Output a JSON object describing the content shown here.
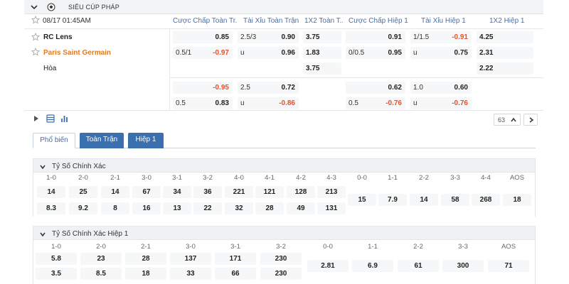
{
  "league": {
    "name": "SIÊU CÚP PHÁP"
  },
  "match": {
    "datetime": "08/17 01:45AM",
    "home": "RC Lens",
    "away": "Paris Saint Germain",
    "draw": "Hòa"
  },
  "columns": [
    "Cược Chấp Toàn Tr...",
    "Tài Xỉu Toàn Trận",
    "1X2 Toàn T...",
    "Cược Chấp Hiệp 1",
    "Tài Xỉu Hiệp 1",
    "1X2 Hiệp 1"
  ],
  "odds": {
    "hdp_ft": [
      {
        "line": "",
        "val": "0.85",
        "neg": false
      },
      {
        "line": "0.5/1",
        "val": "-0.97",
        "neg": true
      },
      {
        "line": "",
        "val": "-0.95",
        "neg": true
      },
      {
        "line": "0.5",
        "val": "0.83",
        "neg": false
      }
    ],
    "ou_ft": [
      {
        "line": "2.5/3",
        "val": "0.90",
        "neg": false
      },
      {
        "line": "u",
        "val": "0.96",
        "neg": false
      },
      {
        "line": "2.5",
        "val": "0.72",
        "neg": false
      },
      {
        "line": "u",
        "val": "-0.86",
        "neg": true
      }
    ],
    "x12_ft": [
      "3.75",
      "1.83",
      "3.75"
    ],
    "hdp_h1": [
      {
        "line": "",
        "val": "0.91",
        "neg": false
      },
      {
        "line": "0/0.5",
        "val": "0.95",
        "neg": false
      },
      {
        "line": "",
        "val": "0.62",
        "neg": false
      },
      {
        "line": "0.5",
        "val": "-0.76",
        "neg": true
      }
    ],
    "ou_h1": [
      {
        "line": "1/1.5",
        "val": "-0.91",
        "neg": true
      },
      {
        "line": "u",
        "val": "0.75",
        "neg": false
      },
      {
        "line": "1.0",
        "val": "0.60",
        "neg": false
      },
      {
        "line": "u",
        "val": "-0.76",
        "neg": true
      }
    ],
    "x12_h1": [
      "4.25",
      "2.31",
      "2.22"
    ]
  },
  "pager": {
    "count": "63"
  },
  "tabs": [
    "Phổ biến",
    "Toàn Trận",
    "Hiệp 1"
  ],
  "correct_score": {
    "title": "Tỷ Số Chính Xác",
    "home_heads": [
      "1-0",
      "2-0",
      "2-1",
      "3-0",
      "3-1",
      "3-2",
      "4-0",
      "4-1",
      "4-2",
      "4-3"
    ],
    "home_row1": [
      "14",
      "25",
      "14",
      "67",
      "34",
      "36",
      "221",
      "121",
      "128",
      "213"
    ],
    "home_row2": [
      "8.3",
      "9.2",
      "8",
      "16",
      "13",
      "22",
      "32",
      "28",
      "49",
      "131"
    ],
    "draw_heads": [
      "0-0",
      "1-1",
      "2-2",
      "3-3",
      "4-4",
      "AOS"
    ],
    "draw_vals": [
      "15",
      "7.9",
      "14",
      "58",
      "268",
      "18"
    ]
  },
  "correct_score_h1": {
    "title": "Tỷ Số Chính Xác Hiệp 1",
    "home_heads": [
      "1-0",
      "2-0",
      "2-1",
      "3-0",
      "3-1",
      "3-2"
    ],
    "home_row1": [
      "5.8",
      "23",
      "28",
      "137",
      "171",
      "230"
    ],
    "home_row2": [
      "3.5",
      "8.5",
      "18",
      "33",
      "66",
      "230"
    ],
    "draw_heads": [
      "0-0",
      "1-1",
      "2-2",
      "3-3",
      "AOS"
    ],
    "draw_vals": [
      "2.81",
      "6.9",
      "61",
      "300",
      "71"
    ]
  }
}
